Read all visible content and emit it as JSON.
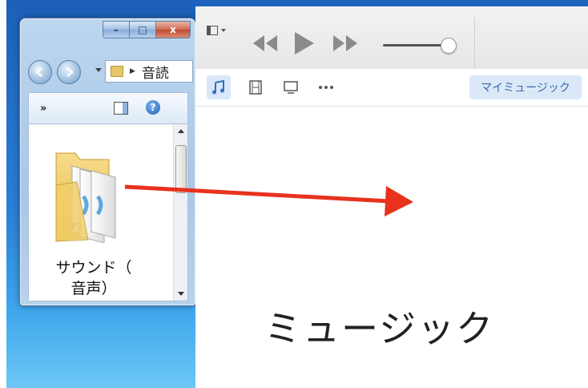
{
  "explorer": {
    "window_controls": {
      "minimize": "–",
      "maximize": "□",
      "close": "x"
    },
    "address_text": "音読",
    "toolbar": {
      "more": "»",
      "help": "?"
    },
    "folder": {
      "name_line1": "サウンド（",
      "name_line2": "音声）",
      "icon": "folder-with-mp3-files-icon",
      "badge": "P3"
    }
  },
  "itunes": {
    "nav": {
      "my_music": "マイミュージック"
    },
    "icons": [
      "music-note-icon",
      "film-icon",
      "tv-icon",
      "more-dots-icon"
    ],
    "title": "ミュージック",
    "volume_level": 0.9
  },
  "colors": {
    "arrow": "#e8321e",
    "accent": "#3a6aa8"
  }
}
